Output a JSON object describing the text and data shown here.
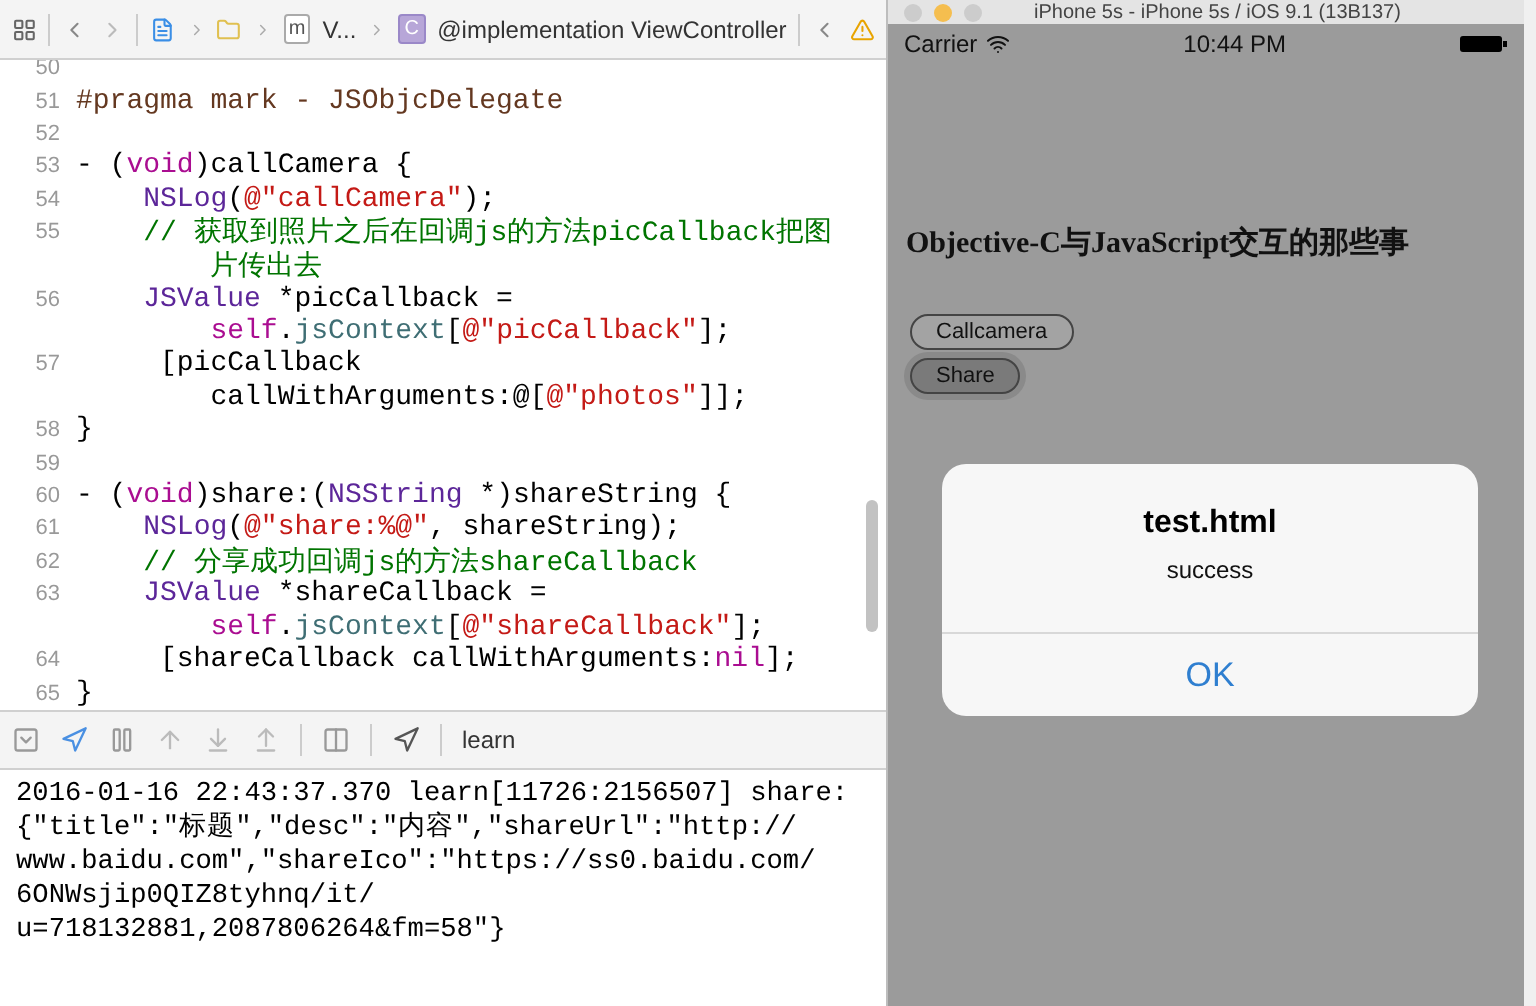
{
  "xcode": {
    "breadcrumb": {
      "file_letter": "m",
      "file_label": "V...",
      "class_letter": "C",
      "symbol_label": "@implementation ViewController"
    },
    "code_lines": [
      {
        "number": "50",
        "rows": [
          []
        ]
      },
      {
        "number": "51",
        "rows": [
          [
            {
              "kind": "preproc",
              "text": "#pragma mark - JSObjcDelegate"
            }
          ]
        ]
      },
      {
        "number": "52",
        "rows": [
          []
        ]
      },
      {
        "number": "53",
        "rows": [
          [
            {
              "kind": "plain",
              "text": "- ("
            },
            {
              "kind": "keyword",
              "text": "void"
            },
            {
              "kind": "plain",
              "text": ")callCamera {"
            }
          ]
        ]
      },
      {
        "number": "54",
        "rows": [
          [
            {
              "kind": "plain",
              "text": "    "
            },
            {
              "kind": "type",
              "text": "NSLog"
            },
            {
              "kind": "plain",
              "text": "("
            },
            {
              "kind": "string",
              "text": "@\"callCamera\""
            },
            {
              "kind": "plain",
              "text": ");"
            }
          ]
        ]
      },
      {
        "number": "55",
        "rows": [
          [
            {
              "kind": "comment",
              "text": "    // 获取到照片之后在回调js的方法picCallback把图"
            }
          ],
          [
            {
              "kind": "comment",
              "text": "        片传出去"
            }
          ]
        ]
      },
      {
        "number": "56",
        "rows": [
          [
            {
              "kind": "type",
              "text": "    JSValue"
            },
            {
              "kind": "plain",
              "text": " *picCallback ="
            }
          ],
          [
            {
              "kind": "keyword",
              "text": "        self"
            },
            {
              "kind": "plain",
              "text": "."
            },
            {
              "kind": "prop",
              "text": "jsContext"
            },
            {
              "kind": "plain",
              "text": "["
            },
            {
              "kind": "string",
              "text": "@\"picCallback\""
            },
            {
              "kind": "plain",
              "text": "];"
            }
          ]
        ]
      },
      {
        "number": "57",
        "rows": [
          [
            {
              "kind": "plain",
              "text": "     [picCallback"
            }
          ],
          [
            {
              "kind": "plain",
              "text": "        callWithArguments:@["
            },
            {
              "kind": "string",
              "text": "@\"photos\""
            },
            {
              "kind": "plain",
              "text": "]];"
            }
          ]
        ]
      },
      {
        "number": "58",
        "rows": [
          [
            {
              "kind": "plain",
              "text": "}"
            }
          ]
        ]
      },
      {
        "number": "59",
        "rows": [
          []
        ]
      },
      {
        "number": "60",
        "rows": [
          [
            {
              "kind": "plain",
              "text": "- ("
            },
            {
              "kind": "keyword",
              "text": "void"
            },
            {
              "kind": "plain",
              "text": ")share:("
            },
            {
              "kind": "type",
              "text": "NSString"
            },
            {
              "kind": "plain",
              "text": " *)shareString {"
            }
          ]
        ]
      },
      {
        "number": "61",
        "rows": [
          [
            {
              "kind": "plain",
              "text": "    "
            },
            {
              "kind": "type",
              "text": "NSLog"
            },
            {
              "kind": "plain",
              "text": "("
            },
            {
              "kind": "string",
              "text": "@\"share:%@\""
            },
            {
              "kind": "plain",
              "text": ", shareString);"
            }
          ]
        ]
      },
      {
        "number": "62",
        "rows": [
          [
            {
              "kind": "comment",
              "text": "    // 分享成功回调js的方法shareCallback"
            }
          ]
        ]
      },
      {
        "number": "63",
        "rows": [
          [
            {
              "kind": "type",
              "text": "    JSValue"
            },
            {
              "kind": "plain",
              "text": " *shareCallback ="
            }
          ],
          [
            {
              "kind": "keyword",
              "text": "        self"
            },
            {
              "kind": "plain",
              "text": "."
            },
            {
              "kind": "prop",
              "text": "jsContext"
            },
            {
              "kind": "plain",
              "text": "["
            },
            {
              "kind": "string",
              "text": "@\"shareCallback\""
            },
            {
              "kind": "plain",
              "text": "];"
            }
          ]
        ]
      },
      {
        "number": "64",
        "rows": [
          [
            {
              "kind": "plain",
              "text": "     [shareCallback callWithArguments:"
            },
            {
              "kind": "keyword",
              "text": "nil"
            },
            {
              "kind": "plain",
              "text": "];"
            }
          ]
        ]
      },
      {
        "number": "65",
        "rows": [
          [
            {
              "kind": "plain",
              "text": "}"
            }
          ]
        ]
      }
    ],
    "debug_target": "learn",
    "console_lines": [
      "2016-01-16 22:43:37.370 learn[11726:2156507] share:",
      "{\"title\":\"标题\",\"desc\":\"内容\",\"shareUrl\":\"http://",
      "www.baidu.com\",\"shareIco\":\"https://ss0.baidu.com/",
      "6ONWsjip0QIZ8tyhnq/it/",
      "u=718132881,2087806264&fm=58\"}"
    ]
  },
  "simulator": {
    "window_title": "iPhone 5s - iPhone 5s / iOS 9.1 (13B137)",
    "carrier": "Carrier",
    "time": "10:44 PM",
    "heading": "Objective-C与JavaScript交互的那些事",
    "buttons": [
      {
        "label": "Callcamera",
        "pressed": false
      },
      {
        "label": "Share",
        "pressed": true
      }
    ],
    "alert": {
      "title": "test.html",
      "message": "success",
      "button": "OK"
    }
  }
}
